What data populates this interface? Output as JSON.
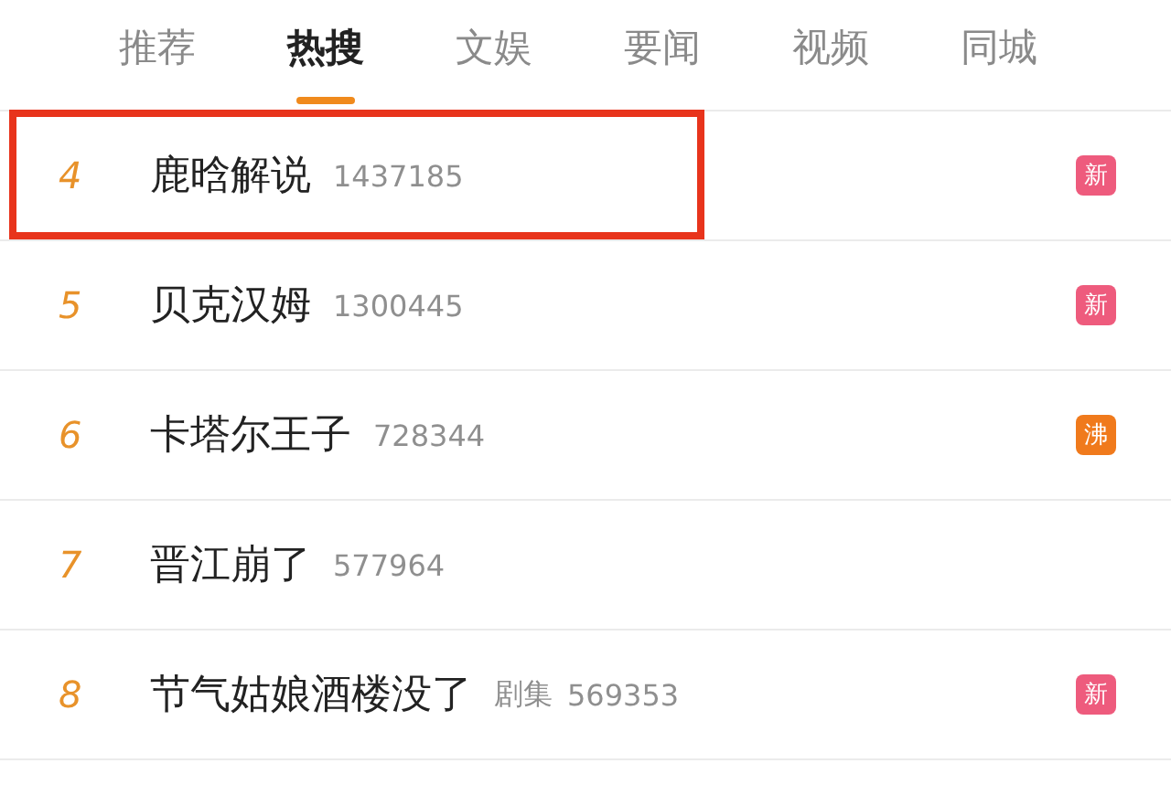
{
  "tabs": [
    {
      "label": "推荐",
      "selected": false
    },
    {
      "label": "热搜",
      "selected": true
    },
    {
      "label": "文娱",
      "selected": false
    },
    {
      "label": "要闻",
      "selected": false
    },
    {
      "label": "视频",
      "selected": false
    },
    {
      "label": "同城",
      "selected": false
    }
  ],
  "rows": [
    {
      "rank": "4",
      "title": "鹿晗解说",
      "count": "1437185",
      "highlighted": true,
      "badge": {
        "text": "新",
        "color": "#ee5b7d"
      }
    },
    {
      "rank": "5",
      "title": "贝克汉姆",
      "count": "1300445",
      "highlighted": false,
      "badge": {
        "text": "新",
        "color": "#ee5b7d"
      }
    },
    {
      "rank": "6",
      "title": "卡塔尔王子",
      "count": "728344",
      "highlighted": false,
      "badge": {
        "text": "沸",
        "color": "#f07a1c"
      }
    },
    {
      "rank": "7",
      "title": "晋江崩了",
      "count": "577964",
      "highlighted": false
    },
    {
      "rank": "8",
      "title": "节气姑娘酒楼没了",
      "category": "剧集",
      "count": "569353",
      "highlighted": false,
      "badge": {
        "text": "新",
        "color": "#ee5b7d"
      }
    }
  ]
}
